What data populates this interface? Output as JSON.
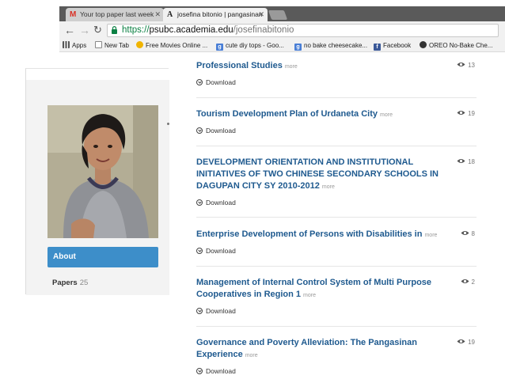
{
  "browser": {
    "tabs": [
      {
        "label": "Your top paper last week",
        "icon": "gmail-icon",
        "active": false
      },
      {
        "label": "josefina bitonio | pangasinan",
        "icon": "academia-icon",
        "active": true
      }
    ],
    "url": {
      "scheme": "https://",
      "host": "psubc.academia.edu",
      "path": "/josefinabitonio"
    },
    "bookmarks": [
      {
        "label": "Apps",
        "icon": "apps-grid-icon"
      },
      {
        "label": "New Tab",
        "icon": "page-icon"
      },
      {
        "label": "Free Movies Online ...",
        "icon": "smiley-icon"
      },
      {
        "label": "cute diy tops - Goo...",
        "icon": "google-icon"
      },
      {
        "label": "no bake cheesecake...",
        "icon": "google-icon"
      },
      {
        "label": "Facebook",
        "icon": "facebook-icon"
      },
      {
        "label": "OREO No-Bake Che...",
        "icon": "gear-icon"
      }
    ]
  },
  "profile": {
    "about_label": "About",
    "papers_label": "Papers",
    "papers_count": "25"
  },
  "papers": [
    {
      "title": "Professional Studies",
      "more": "more",
      "views": "13",
      "download": "Download"
    },
    {
      "title": "Tourism Development Plan of Urdaneta City",
      "more": "more",
      "views": "19",
      "download": "Download"
    },
    {
      "title": "DEVELOPMENT ORIENTATION AND INSTITUTIONAL INITIATIVES OF TWO CHINESE SECONDARY SCHOOLS IN DAGUPAN CITY SY 2010-2012",
      "more": "more",
      "views": "18",
      "download": "Download"
    },
    {
      "title": "Enterprise Development of Persons with Disabilities in",
      "more": "more",
      "views": "8",
      "download": "Download"
    },
    {
      "title": "Management of Internal Control System of Multi Purpose Cooperatives in Region 1",
      "more": "more",
      "views": "2",
      "download": "Download"
    },
    {
      "title": "Governance and Poverty Alleviation: The Pangasinan Experience",
      "more": "more",
      "views": "19",
      "download": "Download"
    }
  ],
  "colors": {
    "link": "#1f5a8f",
    "about_button": "#3d8ec9",
    "https": "#0b8043"
  }
}
